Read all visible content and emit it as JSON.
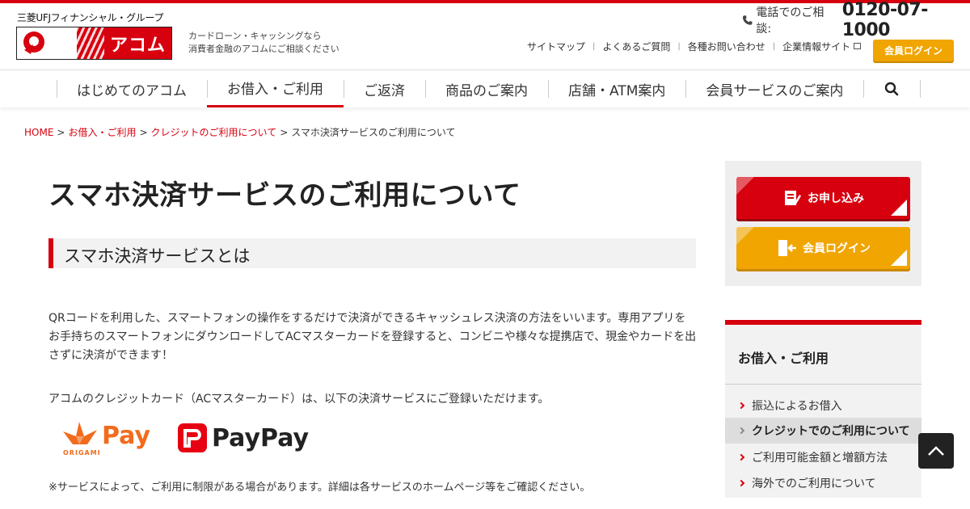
{
  "header": {
    "group_name": "三菱UFJフィナンシャル・グループ",
    "brand": "アコム",
    "tagline_line1": "カードローン・キャッシングなら",
    "tagline_line2": "消費者金融のアコムにご相談ください",
    "phone_label": "電話でのご相談:",
    "phone_number": "0120-07-1000",
    "utility_links": [
      "サイトマップ",
      "よくあるご質問",
      "各種お問い合わせ",
      "企業情報サイト"
    ],
    "login_label": "会員ログイン"
  },
  "nav": {
    "items": [
      "はじめてのアコム",
      "お借入・ご利用",
      "ご返済",
      "商品のご案内",
      "店舗・ATM案内",
      "会員サービスのご案内"
    ],
    "active_index": 1
  },
  "breadcrumb": {
    "items": [
      "HOME",
      "お借入・ご利用",
      "クレジットのご利用について"
    ],
    "current": "スマホ決済サービスのご利用について",
    "separator": ">"
  },
  "main": {
    "title": "スマホ決済サービスのご利用について",
    "section_heading": "スマホ決済サービスとは",
    "paragraph_line1": "QRコードを利用した、スマートフォンの操作をするだけで決済ができるキャッシュレス決済の方法をいいます。専用アプリを",
    "paragraph_line2": "お手持ちのスマートフォンにダウンロードしてACマスターカードを登録すると、コンビニや様々な提携店で、現金やカードを出",
    "paragraph_line3": "さずに決済ができます！",
    "paragraph2": "アコムのクレジットカード（ACマスターカード）は、以下の決済サービスにご登録いただけます。",
    "service_logos": {
      "origami_pay": "Pay",
      "origami_sub": "ORIGAMI",
      "paypay": "PayPay"
    },
    "note": "※サービスによって、ご利用に制限がある場合があります。詳細は各サービスのホームページ等をご確認ください。"
  },
  "sidebar": {
    "apply_label": "お申し込み",
    "member_login_label": "会員ログイン",
    "menu_title": "お借入・ご利用",
    "menu_items": [
      "振込によるお借入",
      "クレジットでのご利用について",
      "ご利用可能金額と増額方法",
      "海外でのご利用について"
    ],
    "current_index": 1
  },
  "colors": {
    "brand_red": "#d7000f",
    "accent_orange": "#f0a500",
    "origami_orange": "#f26b1d",
    "paypay_red": "#e60012"
  },
  "icons": {
    "phone": "phone-icon",
    "search": "search-icon",
    "external": "external-link-icon",
    "page_top": "arrow-up-icon"
  }
}
